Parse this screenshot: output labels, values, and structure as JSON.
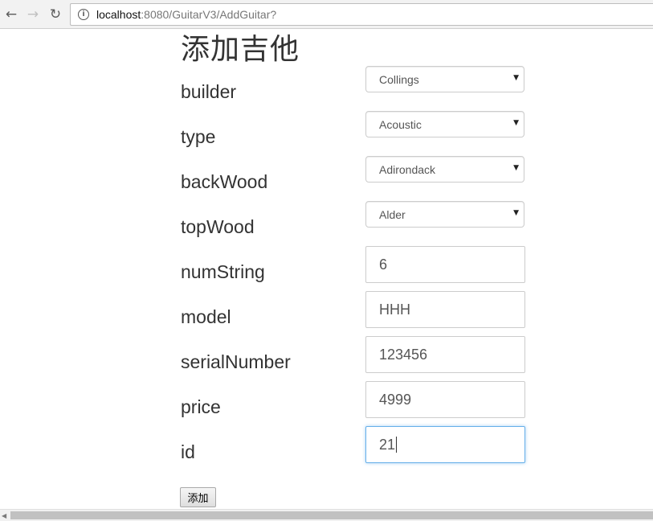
{
  "browser": {
    "url_host": "localhost",
    "url_rest": ":8080/GuitarV3/AddGuitar?"
  },
  "page": {
    "title": "添加吉他",
    "submit_label": "添加"
  },
  "fields": {
    "builder": {
      "label": "builder",
      "value": "Collings"
    },
    "type": {
      "label": "type",
      "value": "Acoustic"
    },
    "backWood": {
      "label": "backWood",
      "value": "Adirondack"
    },
    "topWood": {
      "label": "topWood",
      "value": "Alder"
    },
    "numString": {
      "label": "numString",
      "value": "6"
    },
    "model": {
      "label": "model",
      "value": "HHH"
    },
    "serialNumber": {
      "label": "serialNumber",
      "value": "123456"
    },
    "price": {
      "label": "price",
      "value": "4999"
    },
    "id": {
      "label": "id",
      "value": "21"
    }
  },
  "colors": {
    "focus_border": "#66afe9",
    "label_text": "#333333"
  }
}
